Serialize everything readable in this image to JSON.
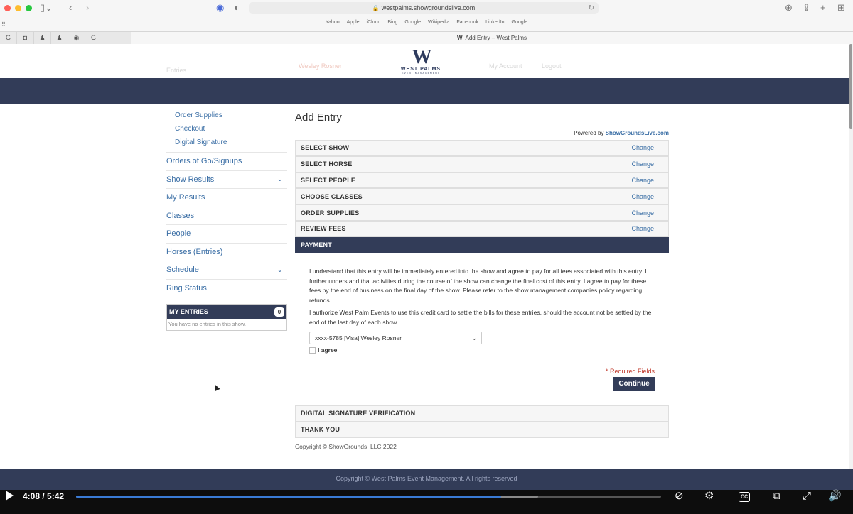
{
  "browser": {
    "url": "westpalms.showgroundslive.com",
    "favorites": [
      "Yahoo",
      "Apple",
      "iCloud",
      "Bing",
      "Google",
      "Wikipedia",
      "Facebook",
      "LinkedIn",
      "Google"
    ],
    "active_tab_title": "Add Entry – West Palms",
    "pinned_tabs": [
      "G",
      "◘",
      "♟",
      "♟",
      "◉",
      "G",
      ""
    ]
  },
  "site": {
    "logo_letter": "W",
    "logo_name": "WEST PALMS",
    "logo_sub": "EVENT MANAGEMENT",
    "faded_left": "Entries",
    "faded_user": "Wesley Rosner",
    "faded_account": "My Account",
    "faded_logout": "Logout"
  },
  "sidebar": {
    "sub_links": [
      "Order Supplies",
      "Checkout",
      "Digital Signature"
    ],
    "items": [
      {
        "label": "Orders of Go/Signups",
        "chevron": false
      },
      {
        "label": "Show Results",
        "chevron": true
      },
      {
        "label": "My Results",
        "chevron": false
      },
      {
        "label": "Classes",
        "chevron": false
      },
      {
        "label": "People",
        "chevron": false
      },
      {
        "label": "Horses (Entries)",
        "chevron": false
      },
      {
        "label": "Schedule",
        "chevron": true
      },
      {
        "label": "Ring Status",
        "chevron": false
      }
    ],
    "my_entries_title": "MY ENTRIES",
    "my_entries_count": "0",
    "my_entries_message": "You have no entries in this show."
  },
  "main": {
    "title": "Add Entry",
    "powered_prefix": "Powered by ",
    "powered_link": "ShowGroundsLive.com",
    "steps": [
      {
        "label": "SELECT SHOW",
        "action": "Change"
      },
      {
        "label": "SELECT HORSE",
        "action": "Change"
      },
      {
        "label": "SELECT PEOPLE",
        "action": "Change"
      },
      {
        "label": "CHOOSE CLASSES",
        "action": "Change"
      },
      {
        "label": "ORDER SUPPLIES",
        "action": "Change"
      },
      {
        "label": "REVIEW FEES",
        "action": "Change"
      }
    ],
    "active_step": "PAYMENT",
    "payment_text_1": "I understand that this entry will be immediately entered into the show and agree to pay for all fees associated with this entry. I further understand that activities during the course of the show can change the final cost of this entry. I agree to pay for these fees by the end of business on the final day of the show. Please refer to the show management companies policy regarding refunds.",
    "payment_text_2": "I authorize West Palm Events to use this credit card to settle the bills for these entries, should the account not be settled by the end of the last day of each show.",
    "card_selected": "xxxx-5785 [Visa] Wesley Rosner",
    "agree_label": "I agree",
    "required_note": "* Required Fields",
    "continue_label": "Continue",
    "later_steps": [
      "DIGITAL SIGNATURE VERIFICATION",
      "THANK YOU"
    ],
    "copyright": "Copyright © ShowGrounds, LLC 2022"
  },
  "footer": {
    "text": "Copyright © West Palms Event Management. All rights reserved"
  },
  "player": {
    "time": "4:08 / 5:42",
    "progress": 0.727,
    "buffered": 0.79
  }
}
